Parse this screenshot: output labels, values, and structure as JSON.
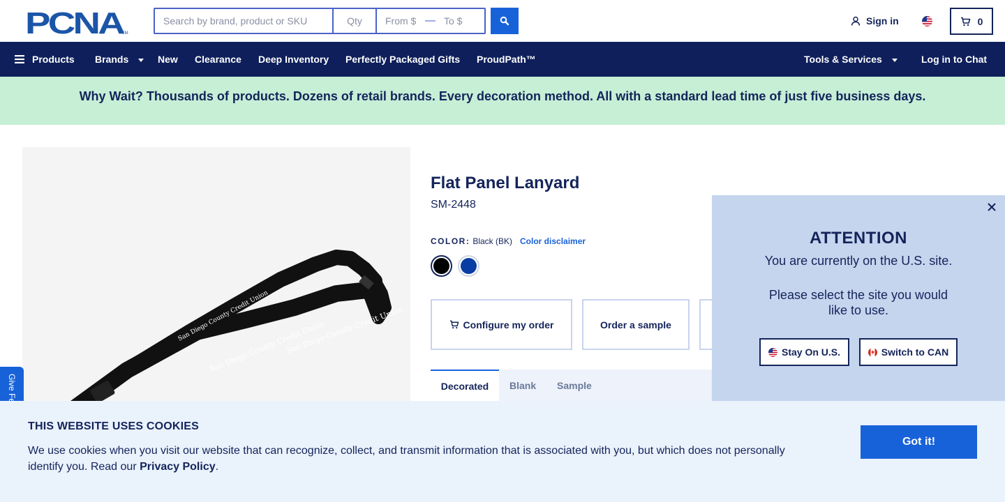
{
  "brand": {
    "logo_text": "PCNA",
    "logo_tm": "TM"
  },
  "search": {
    "placeholder": "Search by brand, product or SKU",
    "qty_placeholder": "Qty",
    "from_placeholder": "From $",
    "to_placeholder": "To $",
    "price_separator": "—"
  },
  "account": {
    "signin_label": "Sign in",
    "cart_count": "0"
  },
  "nav": {
    "products": "Products",
    "brands": "Brands",
    "new": "New",
    "clearance": "Clearance",
    "deep_inventory": "Deep Inventory",
    "gifts": "Perfectly Packaged Gifts",
    "proudpath": "ProudPath™",
    "tools": "Tools & Services",
    "chat": "Log in to Chat"
  },
  "promo": {
    "text": "Why Wait? Thousands of products. Dozens of retail brands. Every decoration method. All with a standard lead time of just five business days."
  },
  "product": {
    "title": "Flat Panel Lanyard",
    "sku": "SM-2448",
    "color_label": "COLOR:",
    "color_value": "Black (BK)",
    "color_disclaimer": "Color disclaimer",
    "lanyard_print": "San Diego County Credit Union",
    "swatches": [
      {
        "name": "Black",
        "hex": "#000000",
        "selected": true
      },
      {
        "name": "Royal Blue",
        "hex": "#0a3da3",
        "selected": false
      }
    ],
    "configure_label": "Configure my order",
    "sample_label": "Order a sample",
    "tabs": [
      "Decorated",
      "Blank",
      "Sample"
    ]
  },
  "feedback": {
    "label": "Give Feedback"
  },
  "attention": {
    "title": "ATTENTION",
    "line1": "You are currently on the U.S. site.",
    "line2": "Please select the site you would like to use.",
    "stay_label": "Stay On U.S.",
    "switch_label": "Switch to CAN"
  },
  "cookies": {
    "title": "THIS WEBSITE USES COOKIES",
    "text": "We use cookies when you visit our website that can recognize, collect, and transmit information that is associated with you, but which does not personally identify you. Read our ",
    "link": "Privacy Policy",
    "end": ".",
    "button": "Got it!"
  },
  "colors": {
    "navy": "#0e1f5b",
    "accent_blue": "#1862d9",
    "promo_bg": "#c6efd6",
    "popup_bg": "#c5d5ee",
    "cookie_bg": "#eaf2fc"
  }
}
